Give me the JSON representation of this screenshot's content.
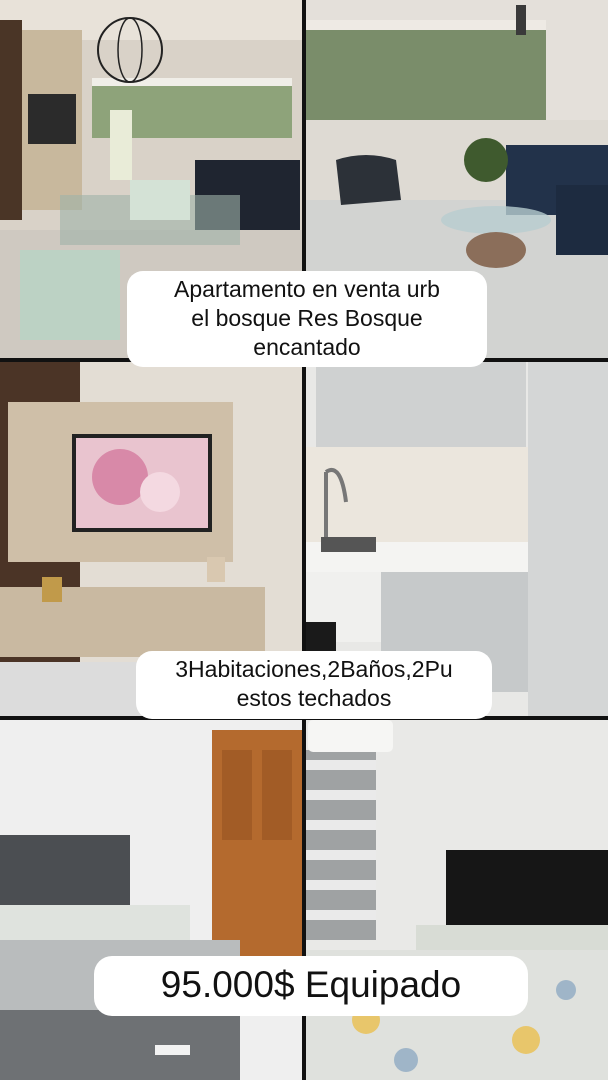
{
  "captions": {
    "title": "Apartamento en venta urb\nel bosque Res Bosque\nencantado",
    "features": "3Habitaciones,2Baños,2Pu\nestos techados",
    "price": "95.000$ Equipado"
  },
  "photos": [
    {
      "scene": "dining room with glass table and green chairs"
    },
    {
      "scene": "living room with blue sofa and glass coffee table"
    },
    {
      "scene": "wood TV wall panel with television"
    },
    {
      "scene": "white kitchen with gray cabinets"
    },
    {
      "scene": "bedroom with gray headboard and wooden door"
    },
    {
      "scene": "bedroom with black headboard, striped blinds and AC unit"
    }
  ]
}
